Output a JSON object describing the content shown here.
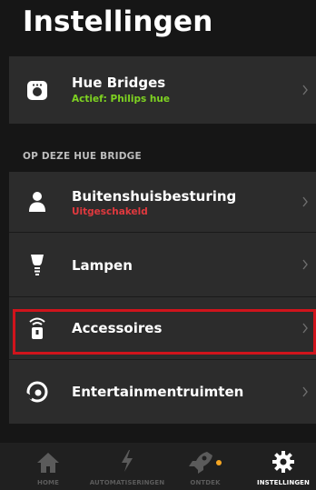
{
  "header": {
    "title": "Instellingen"
  },
  "bridges": {
    "label": "Hue Bridges",
    "status": "Actief: Philips hue",
    "status_color": "#7ed321"
  },
  "section": {
    "title": "OP DEZE HUE BRIDGE"
  },
  "items": [
    {
      "label": "Buitenshuisbesturing",
      "status": "Uitgeschakeld",
      "status_color": "#e0393e"
    },
    {
      "label": "Lampen"
    },
    {
      "label": "Accessoires"
    },
    {
      "label": "Entertainmentruimten"
    }
  ],
  "tabs": [
    {
      "label": "HOME",
      "icon": "home-icon"
    },
    {
      "label": "AUTOMATISERINGEN",
      "icon": "lightning-icon"
    },
    {
      "label": "ONTDEK",
      "icon": "rocket-icon"
    },
    {
      "label": "INSTELLINGEN",
      "icon": "gear-icon",
      "active": true
    }
  ],
  "colors": {
    "background": "#161616",
    "row": "#2c2c2c",
    "highlight": "#d0141c",
    "notification_dot": "#f5a623"
  }
}
